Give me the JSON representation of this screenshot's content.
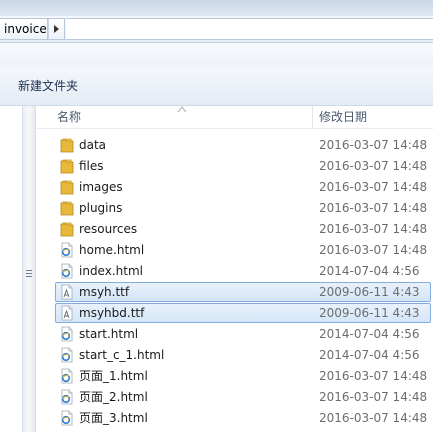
{
  "address": {
    "crumb": "invoice"
  },
  "toolbar": {
    "new_folder_label": "新建文件夹"
  },
  "columns": {
    "name": "名称",
    "date": "修改日期"
  },
  "files": [
    {
      "name": "data",
      "date": "2016-03-07 14:48",
      "icon": "folder-icon",
      "selected": false
    },
    {
      "name": "files",
      "date": "2016-03-07 14:48",
      "icon": "folder-icon",
      "selected": false
    },
    {
      "name": "images",
      "date": "2016-03-07 14:48",
      "icon": "folder-icon",
      "selected": false
    },
    {
      "name": "plugins",
      "date": "2016-03-07 14:48",
      "icon": "folder-icon",
      "selected": false
    },
    {
      "name": "resources",
      "date": "2016-03-07 14:48",
      "icon": "folder-icon",
      "selected": false
    },
    {
      "name": "home.html",
      "date": "2016-03-07 14:48",
      "icon": "html-file-icon",
      "selected": false
    },
    {
      "name": "index.html",
      "date": "2014-07-04 4:56",
      "icon": "html-file-icon",
      "selected": false
    },
    {
      "name": "msyh.ttf",
      "date": "2009-06-11 4:43",
      "icon": "font-file-icon",
      "selected": true
    },
    {
      "name": "msyhbd.ttf",
      "date": "2009-06-11 4:43",
      "icon": "font-file-icon",
      "selected": true
    },
    {
      "name": "start.html",
      "date": "2014-07-04 4:56",
      "icon": "html-file-icon",
      "selected": false
    },
    {
      "name": "start_c_1.html",
      "date": "2014-07-04 4:56",
      "icon": "html-file-icon",
      "selected": false
    },
    {
      "name": "页面_1.html",
      "date": "2016-03-07 14:48",
      "icon": "html-file-icon",
      "selected": false
    },
    {
      "name": "页面_2.html",
      "date": "2016-03-07 14:48",
      "icon": "html-file-icon",
      "selected": false
    },
    {
      "name": "页面_3.html",
      "date": "2016-03-07 14:48",
      "icon": "html-file-icon",
      "selected": false
    }
  ],
  "colors": {
    "folder": "#e8b83a",
    "selection_border": "#84acdd",
    "selection_fill": "#dcebfa",
    "ie_blue": "#2f7fd0"
  }
}
